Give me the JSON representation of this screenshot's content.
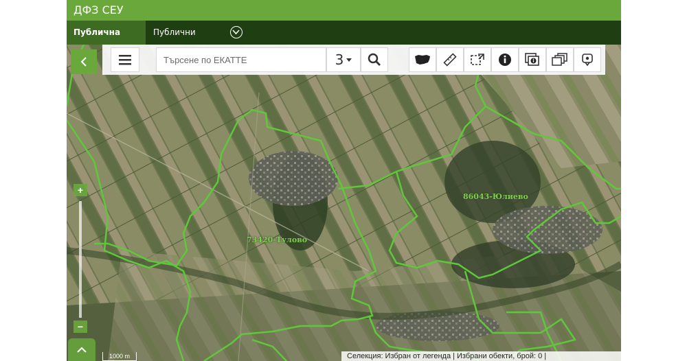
{
  "app": {
    "title": "ДФЗ СЕУ"
  },
  "nav": {
    "public_map": "Публична карта",
    "public_reports": "Публични справки"
  },
  "toolbar": {
    "search_placeholder": "Търсене по ЕКАТТЕ",
    "zoom_select_value": "3",
    "icons": [
      "menu-icon",
      "search-icon",
      "bulgaria-map-icon",
      "ruler-icon",
      "select-area-icon",
      "info-icon",
      "layers-info-icon",
      "layers-icon",
      "location-pin-icon"
    ]
  },
  "map": {
    "labels": {
      "village_1": "73420-Тулово",
      "village_2": "86043-Юлиево"
    },
    "scale_label": "1000 m",
    "status_text": "Селекция: Избран от легенда  |  Избрани обекти, брой: 0  |",
    "colors": {
      "boundary": "#5fc83a",
      "header": "#6aa83c",
      "nav": "#1f3f12",
      "nav_active": "#3d6b21"
    }
  }
}
